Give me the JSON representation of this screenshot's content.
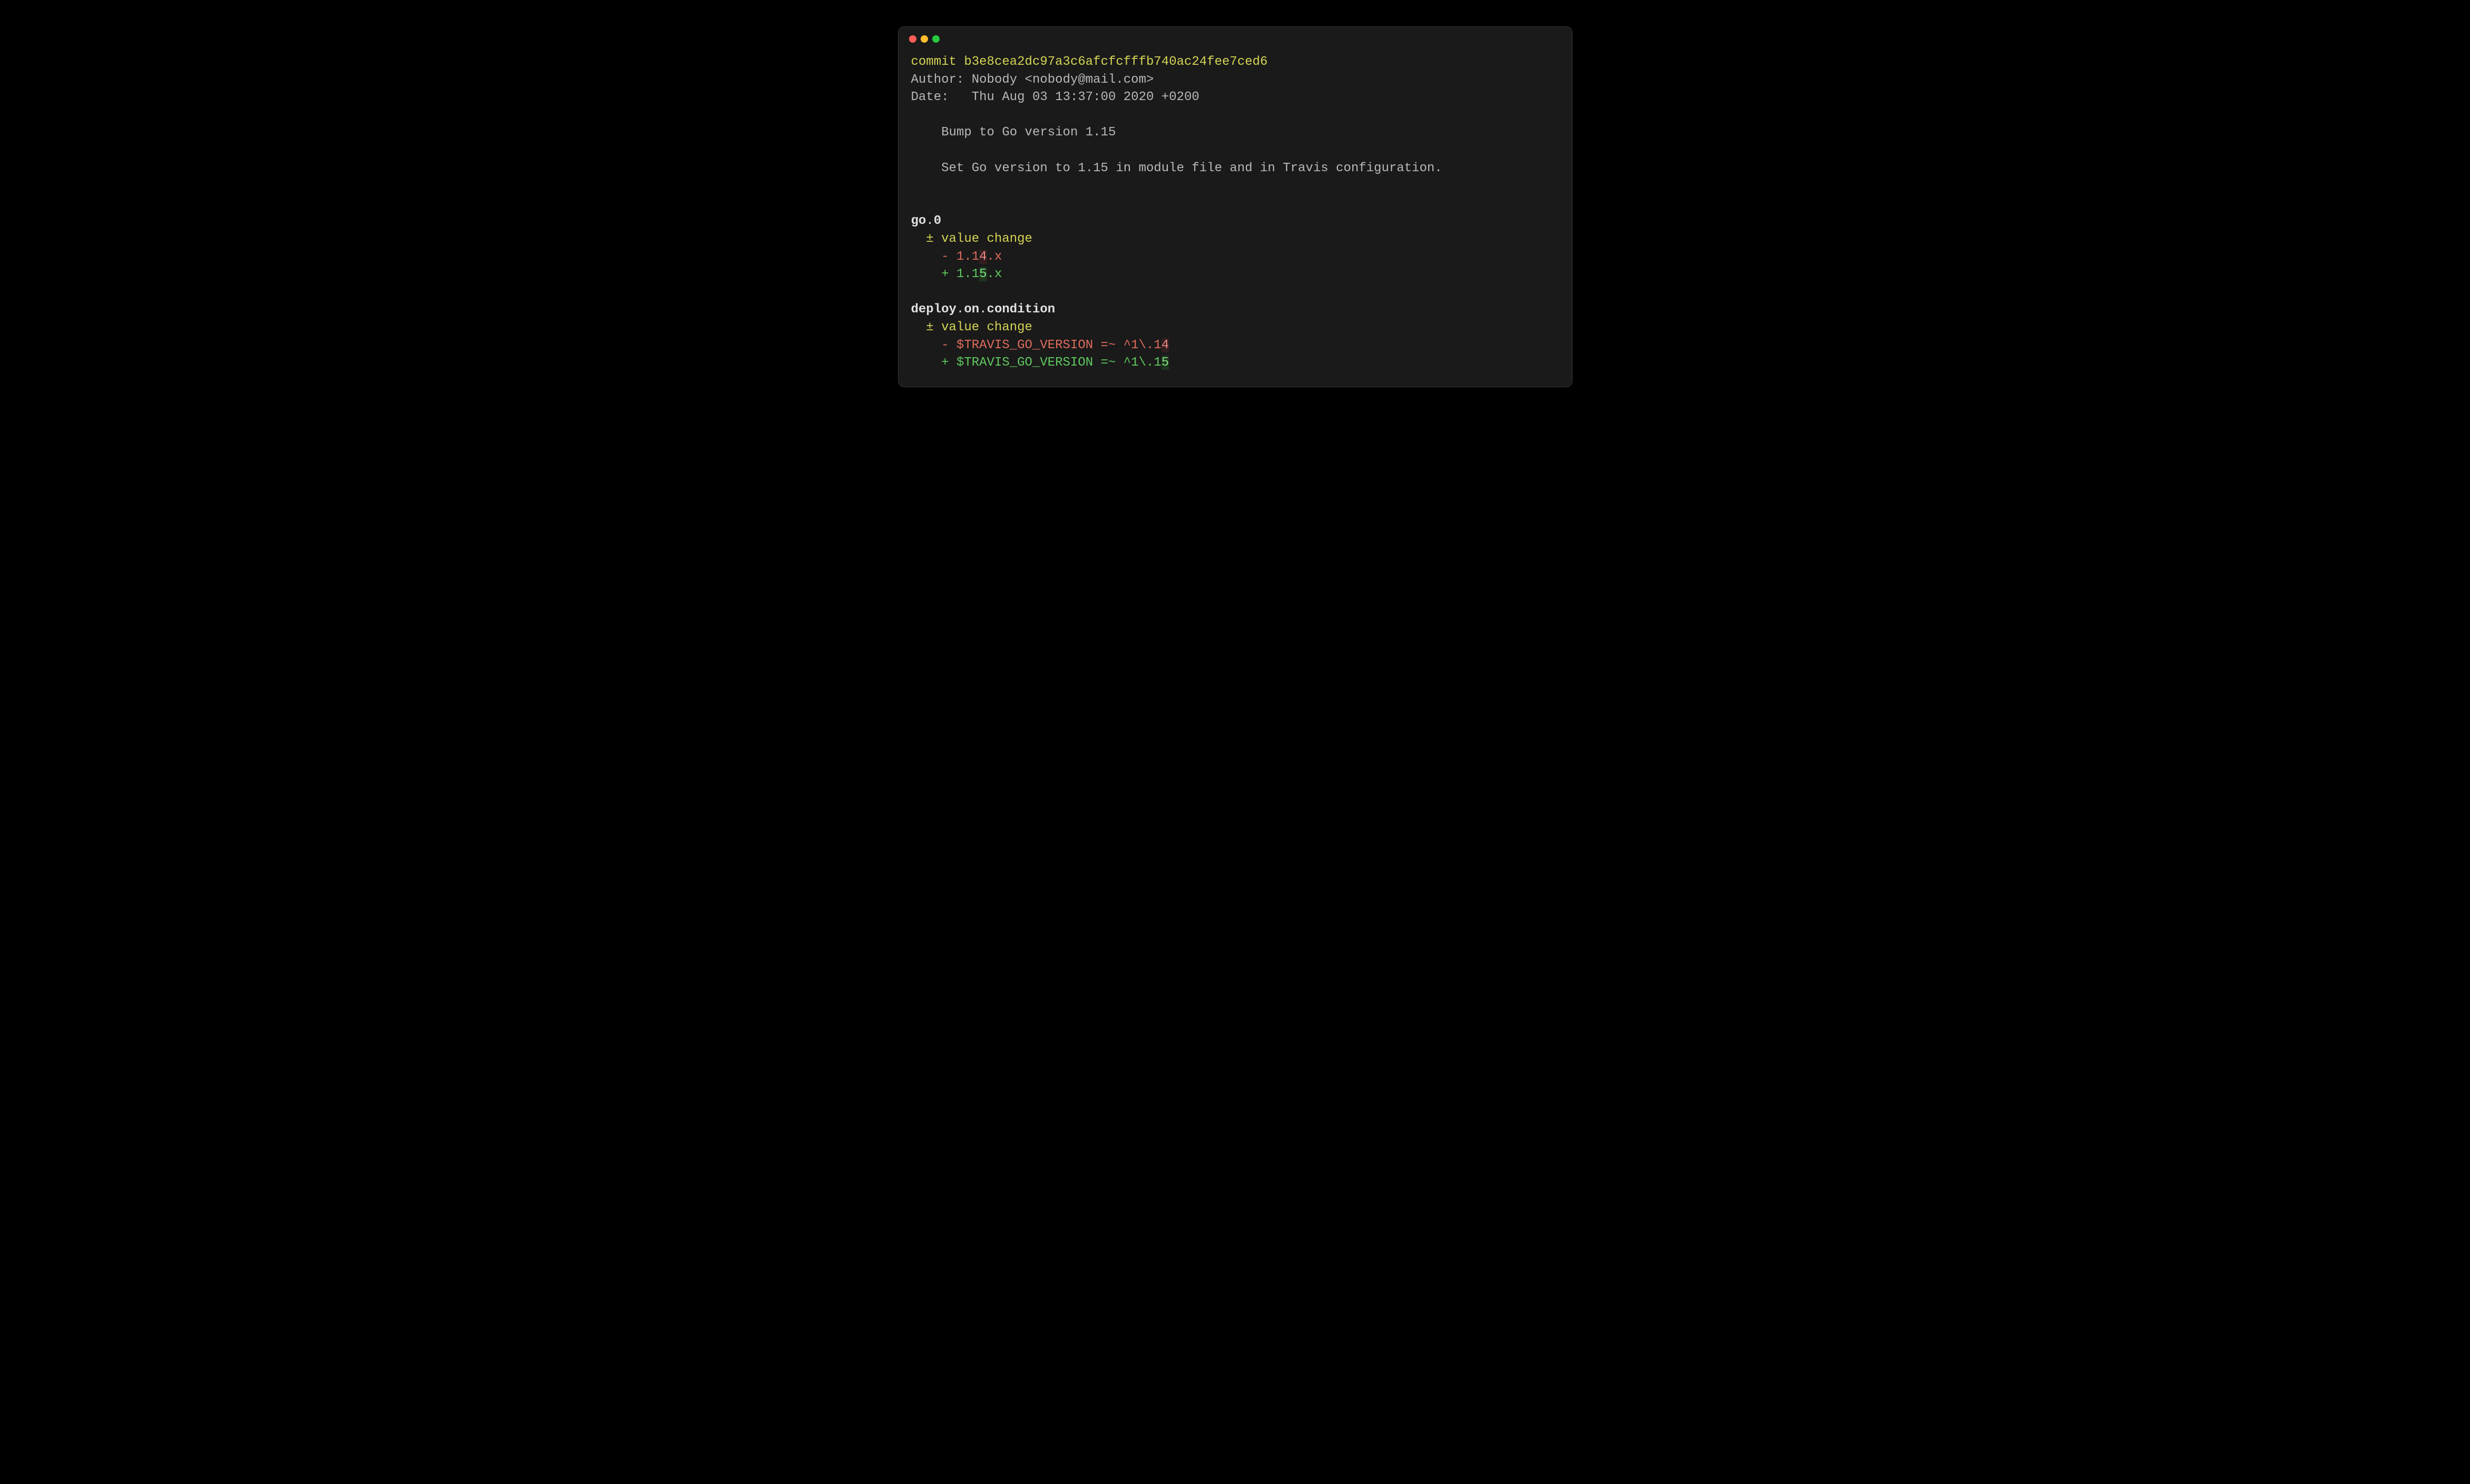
{
  "commit": {
    "label": "commit",
    "hash": "b3e8cea2dc97a3c6afcfcfffb740ac24fee7ced6",
    "author_label": "Author:",
    "author_value": "Nobody <nobody@mail.com>",
    "date_label": "Date:",
    "date_value": "Thu Aug 03 13:37:00 2020 +0200",
    "subject": "Bump to Go version 1.15",
    "body": "Set Go version to 1.15 in module file and in Travis configuration."
  },
  "diffs": [
    {
      "path_parts": [
        "go",
        "0"
      ],
      "change_marker": "±",
      "change_label": "value change",
      "minus": {
        "sign": "-",
        "prefix": "1.1",
        "changed": "4",
        "suffix": ".x"
      },
      "plus": {
        "sign": "+",
        "prefix": "1.1",
        "changed": "5",
        "suffix": ".x"
      }
    },
    {
      "path_parts": [
        "deploy",
        "on",
        "condition"
      ],
      "change_marker": "±",
      "change_label": "value change",
      "minus": {
        "sign": "-",
        "prefix": "$TRAVIS_GO_VERSION =~ ^1\\.1",
        "changed": "4",
        "suffix": ""
      },
      "plus": {
        "sign": "+",
        "prefix": "$TRAVIS_GO_VERSION =~ ^1\\.1",
        "changed": "5",
        "suffix": ""
      }
    }
  ]
}
